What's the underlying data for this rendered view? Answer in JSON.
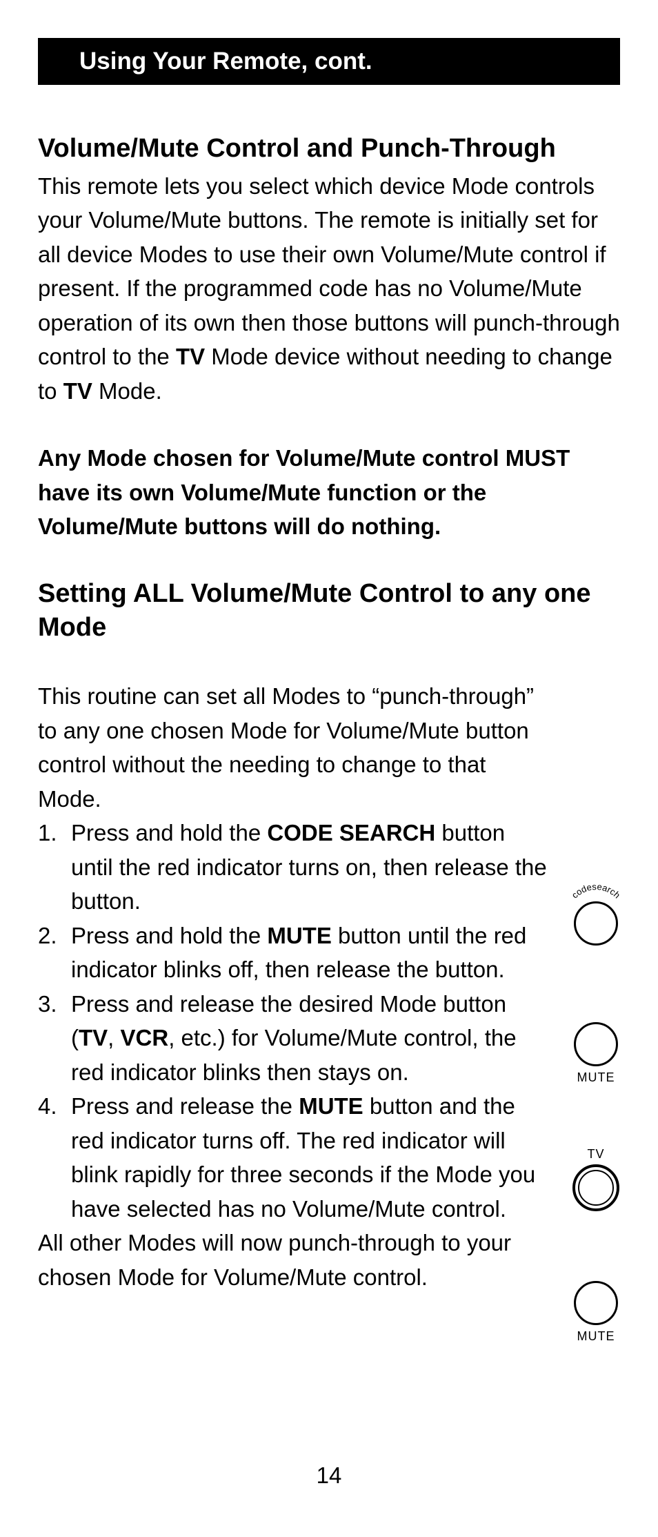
{
  "header": {
    "title": "Using Your Remote, cont."
  },
  "section1": {
    "heading": "Volume/Mute Control and Punch-Through",
    "p1a": "This remote lets you select which device Mode controls your Volume/Mute buttons. The remote is initially set for all device Modes to use their own Volume/Mute control if present. If the programmed code has no Volume/Mute operation of its own then those buttons will punch-through control to the ",
    "p1b_bold": "TV",
    "p1c": " Mode device without needing to change to ",
    "p1d_bold": "TV",
    "p1e": " Mode.",
    "p2_bold": "Any Mode chosen for Volume/Mute control MUST have its own Volume/Mute function or the Volume/Mute buttons will do nothing."
  },
  "section2": {
    "heading": "Setting ALL Volume/Mute Control to any one Mode",
    "intro": "This routine can set all Modes to “punch-through” to any one chosen Mode for Volume/Mute button control without the needing to change to that Mode.",
    "steps": {
      "s1a": "Press and hold the ",
      "s1b_bold": "CODE SEARCH",
      "s1c": " button until the red indicator turns on, then release the button.",
      "s2a": "Press and hold the ",
      "s2b_bold": "MUTE",
      "s2c": " button until the red indicator blinks off, then release the button.",
      "s3a": "Press and release the desired Mode button (",
      "s3b_bold": "TV",
      "s3c": ", ",
      "s3d_bold": "VCR",
      "s3e": ", etc.) for Volume/Mute control, the red indicator blinks then stays on.",
      "s4a": "Press and release the ",
      "s4b_bold": "MUTE",
      "s4c": " button and the red indicator turns off. The red indicator will blink rapidly for three seconds if the Mode you have selected has no Volume/Mute control."
    },
    "outro": "All other Modes will now punch-through to your chosen Mode for Volume/Mute control."
  },
  "buttons": {
    "codesearch": "codesearch",
    "mute": "MUTE",
    "tv": "TV"
  },
  "page_number": "14"
}
